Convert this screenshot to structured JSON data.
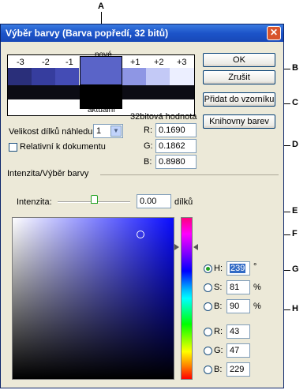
{
  "dialog": {
    "title": "Výběr barvy (Barva popředí, 32 bitů)",
    "close_glyph": "✕"
  },
  "callouts": [
    "A",
    "B",
    "C",
    "D",
    "E",
    "F",
    "G",
    "H"
  ],
  "preview": {
    "new_label": "nové",
    "current_label": "aktuální",
    "stops": [
      "-3",
      "-2",
      "-1",
      "+1",
      "+2",
      "+3"
    ]
  },
  "buttons": {
    "ok": "OK",
    "cancel": "Zrušit",
    "add_to_swatches": "Přidat do vzorníku",
    "color_libraries": "Knihovny barev"
  },
  "preview_size": {
    "label": "Velikost dílků náhledu:",
    "value": "1"
  },
  "relative_to_doc": {
    "label": "Relativní k dokumentu",
    "checked": false
  },
  "float_values": {
    "heading": "32bitová hodnota",
    "r_label": "R:",
    "r": "0.1690",
    "g_label": "G:",
    "g": "0.1862",
    "b_label": "B:",
    "b": "0.8980"
  },
  "intensity_section": {
    "title": "Intenzita/Výběr barvy",
    "label": "Intenzita:",
    "value": "0.00",
    "unit": "dílků"
  },
  "hsb_rgb": {
    "h_label": "H:",
    "h": "239",
    "h_unit": "°",
    "s_label": "S:",
    "s": "81",
    "s_unit": "%",
    "b_label": "B:",
    "b": "90",
    "b_unit": "%",
    "r_label": "R:",
    "r": "43",
    "g_label": "G:",
    "g": "47",
    "b2_label": "B:",
    "b2": "229",
    "selected": "H"
  },
  "colors": {
    "new_color": "#5a64c8",
    "current_color": "#000000",
    "accent_hue": "#2b2fe5"
  }
}
